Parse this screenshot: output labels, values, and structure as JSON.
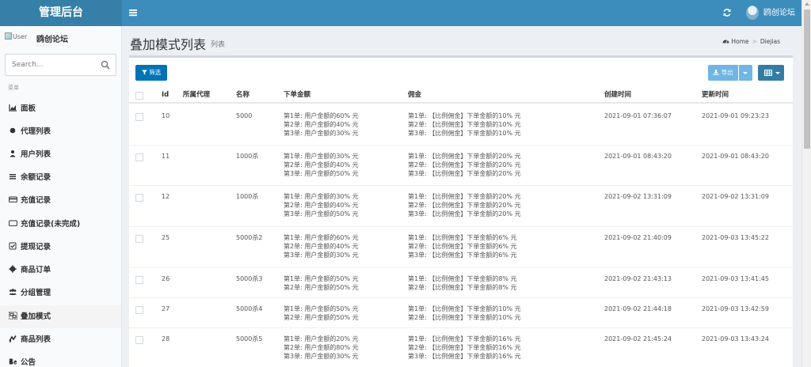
{
  "header": {
    "brand": "管理后台",
    "user_name": "鸥创论坛"
  },
  "sidebar": {
    "user_image_alt": "User",
    "user_name": "鸥创论坛",
    "user_sub": "- - - -",
    "search_placeholder": "Search...",
    "menu_header": "菜单",
    "items": [
      {
        "label": "面板",
        "icon": "area-chart-icon"
      },
      {
        "label": "代理列表",
        "icon": "dot-circle-icon"
      },
      {
        "label": "用户列表",
        "icon": "users-icon"
      },
      {
        "label": "余额记录",
        "icon": "list-icon"
      },
      {
        "label": "充值记录",
        "icon": "credit-card-icon"
      },
      {
        "label": "充值记录(未完成)",
        "icon": "card-outline-icon"
      },
      {
        "label": "提现记录",
        "icon": "check-square-icon"
      },
      {
        "label": "商品订单",
        "icon": "gear-icon"
      },
      {
        "label": "分组管理",
        "icon": "group-icon"
      },
      {
        "label": "叠加模式",
        "icon": "object-group-icon"
      },
      {
        "label": "商品列表",
        "icon": "sliders-icon"
      },
      {
        "label": "公告",
        "icon": "behance-icon"
      }
    ]
  },
  "page": {
    "title": "叠加模式列表",
    "subtitle": "列表",
    "breadcrumb": [
      "Home",
      "Diejias"
    ]
  },
  "toolbar": {
    "filter_label": "筛选",
    "export_label": "导出"
  },
  "colors": {
    "header": "#3c8dbc",
    "brand_bg": "#367fa9",
    "filter_btn": "#0073b7",
    "export_btn": "#6fb6e6",
    "columns_btn": "#357ca5"
  },
  "table": {
    "headers": [
      "Id",
      "所属代理",
      "名称",
      "下单金额",
      "佣金",
      "创建时间",
      "更新时间"
    ],
    "rows": [
      {
        "id": "10",
        "agent": "",
        "name": "5000",
        "amount": [
          "第1单: 用户金额的60% 元",
          "第2单: 用户金额的40% 元",
          "第3单: 用户金额的30% 元"
        ],
        "commission": [
          "第1单: 【比例佣金】下单金额的10% 元",
          "第2单: 【比例佣金】下单金额的10% 元",
          "第3单: 【比例佣金】下单金额的10% 元"
        ],
        "created": "2021-09-01 07:36:07",
        "updated": "2021-09-01 09:23:23"
      },
      {
        "id": "11",
        "agent": "",
        "name": "1000杀",
        "amount": [
          "第1单: 用户金额的30% 元",
          "第2单: 用户金额的40% 元",
          "第3单: 用户金额的50% 元"
        ],
        "commission": [
          "第1单: 【比例佣金】下单金额的20% 元",
          "第2单: 【比例佣金】下单金额的20% 元",
          "第3单: 【比例佣金】下单金额的20% 元"
        ],
        "created": "2021-09-01 08:43:20",
        "updated": "2021-09-01 08:43:20"
      },
      {
        "id": "12",
        "agent": "",
        "name": "1000杀",
        "amount": [
          "第1单: 用户金额的30% 元",
          "第2单: 用户金额的40% 元",
          "第3单: 用户金额的50% 元"
        ],
        "commission": [
          "第1单: 【比例佣金】下单金额的20% 元",
          "第2单: 【比例佣金】下单金额的20% 元",
          "第3单: 【比例佣金】下单金额的20% 元"
        ],
        "created": "2021-09-02 13:31:09",
        "updated": "2021-09-02 13:31:09"
      },
      {
        "id": "25",
        "agent": "",
        "name": "5000杀2",
        "amount": [
          "第1单: 用户金额的60% 元",
          "第2单: 用户金额的40% 元",
          "第3单: 用户金额的30% 元"
        ],
        "commission": [
          "第1单: 【比例佣金】下单金额的6% 元",
          "第2单: 【比例佣金】下单金额的6% 元",
          "第3单: 【比例佣金】下单金额的6% 元"
        ],
        "created": "2021-09-02 21:40:09",
        "updated": "2021-09-03 13:45:22"
      },
      {
        "id": "26",
        "agent": "",
        "name": "5000杀3",
        "amount": [
          "第1单: 用户金额的50% 元",
          "第2单: 用户金额的50% 元"
        ],
        "commission": [
          "第1单: 【比例佣金】下单金额的8% 元",
          "第2单: 【比例佣金】下单金额的8% 元"
        ],
        "created": "2021-09-02 21:43:13",
        "updated": "2021-09-03 13:41:45"
      },
      {
        "id": "27",
        "agent": "",
        "name": "5000杀4",
        "amount": [
          "第1单: 用户金额的50% 元",
          "第2单: 用户金额的50% 元"
        ],
        "commission": [
          "第1单: 【比例佣金】下单金额的10% 元",
          "第2单: 【比例佣金】下单金额的10% 元"
        ],
        "created": "2021-09-02 21:44:18",
        "updated": "2021-09-03 13:42:59"
      },
      {
        "id": "28",
        "agent": "",
        "name": "5000杀5",
        "amount": [
          "第1单: 用户金额的20% 元",
          "第2单: 用户金额的80% 元",
          "第3单: 用户金额的30% 元"
        ],
        "commission": [
          "第1单: 【比例佣金】下单金额的16% 元",
          "第2单: 【比例佣金】下单金额的16% 元",
          "第3单: 【比例佣金】下单金额的16% 元"
        ],
        "created": "2021-09-02 21:45:24",
        "updated": "2021-09-03 13:43:24"
      }
    ]
  }
}
